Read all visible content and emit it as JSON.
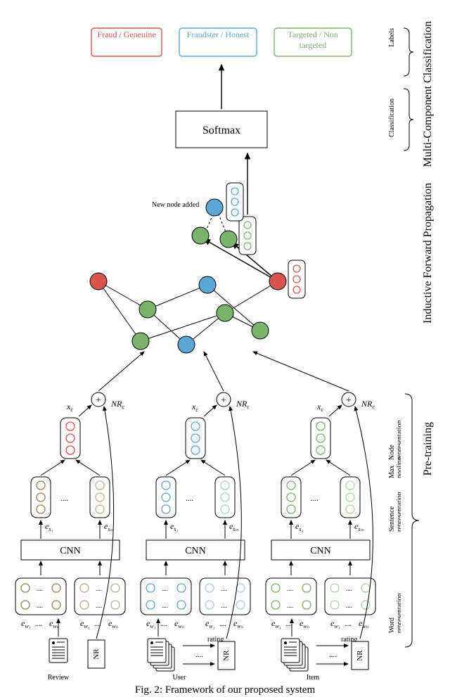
{
  "caption_prefix": "Fig. 2:",
  "caption_rest": "Framework of our proposed system",
  "sections": {
    "pretraining": "Pre-training",
    "inductive": "Inductive Forward Propagation",
    "multi": "Multi-Component Classification"
  },
  "subsections": {
    "word": "Word representation",
    "sentence": "Sentence representation",
    "maxpool": "Max pooling",
    "noderep": "Node representation",
    "classification": "Classification",
    "labels": "Labels"
  },
  "blocks": {
    "cnn": "CNN",
    "nr": "NR",
    "softmax": "Softmax"
  },
  "entities": {
    "review": "Review",
    "user": "User",
    "item": "Item",
    "rating": "rating"
  },
  "annotations": {
    "new_node": "New node added"
  },
  "labels": {
    "fraud": "Fraud / Geneuine",
    "fraudster": "Fraudster / Honest",
    "targeted": "Targeted / Non targeted"
  },
  "math": {
    "ew1": "e",
    "ew1_sub": "w₁",
    "ewn": "e",
    "ewn_sub": "wₙ",
    "es1": "e",
    "es1_sub": "s₁",
    "esm": "e",
    "esm_sub": "sₘ",
    "xc": "x",
    "xc_sub": "c",
    "nrc": "NR",
    "nrc_sub": "c",
    "dots": "....",
    "plus": "+"
  },
  "colors": {
    "red": "#d9544d",
    "blue": "#5aa7d6",
    "green": "#7ab36a",
    "brown": "#a57c52"
  }
}
